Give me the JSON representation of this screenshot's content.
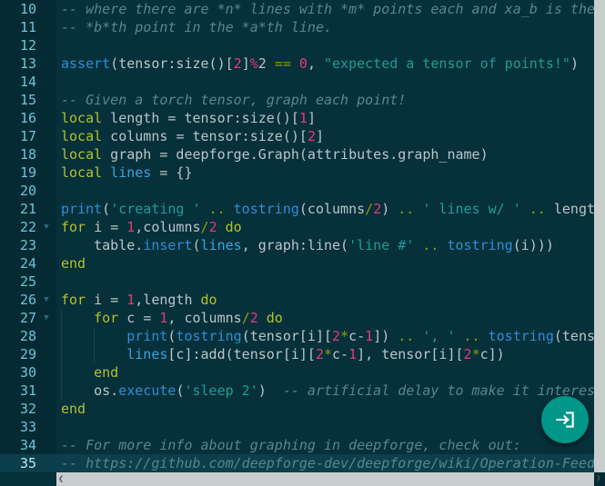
{
  "editor": {
    "language": "lua",
    "first_line": 10,
    "active_line": 35,
    "colors": {
      "background": "#06303a",
      "gutter_background": "#042b34",
      "active_line": "#0a3f4b",
      "comment": "#59868f",
      "keyword": "#b3c22b",
      "function": "#2f8fd6",
      "string": "#1d9e96",
      "number": "#e03c7a",
      "operator": "#8fa000",
      "plain_text": "#b9c6c9",
      "line_number": "#6fc3d6",
      "fab": "#009688",
      "scrollbar": "#c9cdce"
    },
    "lines": [
      {
        "number": "10",
        "fold": false,
        "indent_guides": 0,
        "active": false,
        "tokens": [
          {
            "t": "-- where there are *n* lines with *m* points each and xa_b is the x v",
            "c": "cm"
          }
        ]
      },
      {
        "number": "11",
        "fold": false,
        "indent_guides": 0,
        "active": false,
        "tokens": [
          {
            "t": "-- *b*th point in the *a*th line.",
            "c": "cm"
          }
        ]
      },
      {
        "number": "12",
        "fold": false,
        "indent_guides": 0,
        "active": false,
        "tokens": []
      },
      {
        "number": "13",
        "fold": false,
        "indent_guides": 0,
        "active": false,
        "tokens": [
          {
            "t": "assert",
            "c": "fn"
          },
          {
            "t": "(tensor:size()[",
            "c": "pl"
          },
          {
            "t": "2",
            "c": "num"
          },
          {
            "t": "]",
            "c": "pl"
          },
          {
            "t": "%",
            "c": "num"
          },
          {
            "t": "2",
            "c": "pl"
          },
          {
            "t": " ",
            "c": "pl"
          },
          {
            "t": "==",
            "c": "op"
          },
          {
            "t": " ",
            "c": "pl"
          },
          {
            "t": "0",
            "c": "num"
          },
          {
            "t": ", ",
            "c": "pl"
          },
          {
            "t": "\"expected a tensor of points!\"",
            "c": "str"
          },
          {
            "t": ")",
            "c": "pl"
          }
        ]
      },
      {
        "number": "14",
        "fold": false,
        "indent_guides": 0,
        "active": false,
        "tokens": []
      },
      {
        "number": "15",
        "fold": false,
        "indent_guides": 0,
        "active": false,
        "tokens": [
          {
            "t": "-- Given a torch tensor, graph each point!",
            "c": "cm"
          }
        ]
      },
      {
        "number": "16",
        "fold": false,
        "indent_guides": 0,
        "active": false,
        "tokens": [
          {
            "t": "local",
            "c": "kw"
          },
          {
            "t": " length ",
            "c": "pl"
          },
          {
            "t": "=",
            "c": "pl"
          },
          {
            "t": " tensor:size()[",
            "c": "pl"
          },
          {
            "t": "1",
            "c": "num"
          },
          {
            "t": "]",
            "c": "pl"
          }
        ]
      },
      {
        "number": "17",
        "fold": false,
        "indent_guides": 0,
        "active": false,
        "tokens": [
          {
            "t": "local",
            "c": "kw"
          },
          {
            "t": " columns ",
            "c": "pl"
          },
          {
            "t": "=",
            "c": "pl"
          },
          {
            "t": " tensor:size()[",
            "c": "pl"
          },
          {
            "t": "2",
            "c": "num"
          },
          {
            "t": "]",
            "c": "pl"
          }
        ]
      },
      {
        "number": "18",
        "fold": false,
        "indent_guides": 0,
        "active": false,
        "tokens": [
          {
            "t": "local",
            "c": "kw"
          },
          {
            "t": " graph ",
            "c": "pl"
          },
          {
            "t": "=",
            "c": "pl"
          },
          {
            "t": " deepforge.Graph(attributes.graph_name)",
            "c": "pl"
          }
        ]
      },
      {
        "number": "19",
        "fold": false,
        "indent_guides": 0,
        "active": false,
        "tokens": [
          {
            "t": "local",
            "c": "kw"
          },
          {
            "t": " ",
            "c": "pl"
          },
          {
            "t": "lines",
            "c": "var"
          },
          {
            "t": " ",
            "c": "pl"
          },
          {
            "t": "=",
            "c": "pl"
          },
          {
            "t": " {}",
            "c": "pl"
          }
        ]
      },
      {
        "number": "20",
        "fold": false,
        "indent_guides": 0,
        "active": false,
        "tokens": []
      },
      {
        "number": "21",
        "fold": false,
        "indent_guides": 0,
        "active": false,
        "tokens": [
          {
            "t": "print",
            "c": "fn"
          },
          {
            "t": "(",
            "c": "pl"
          },
          {
            "t": "'creating '",
            "c": "str"
          },
          {
            "t": " ",
            "c": "pl"
          },
          {
            "t": "..",
            "c": "op"
          },
          {
            "t": " ",
            "c": "pl"
          },
          {
            "t": "tostring",
            "c": "fn"
          },
          {
            "t": "(columns",
            "c": "pl"
          },
          {
            "t": "/",
            "c": "op"
          },
          {
            "t": "2",
            "c": "num"
          },
          {
            "t": ") ",
            "c": "pl"
          },
          {
            "t": "..",
            "c": "op"
          },
          {
            "t": " ",
            "c": "pl"
          },
          {
            "t": "' lines w/ '",
            "c": "str"
          },
          {
            "t": " ",
            "c": "pl"
          },
          {
            "t": "..",
            "c": "op"
          },
          {
            "t": " length ",
            "c": "pl"
          },
          {
            "t": "..",
            "c": "op"
          }
        ]
      },
      {
        "number": "22",
        "fold": true,
        "indent_guides": 0,
        "active": false,
        "tokens": [
          {
            "t": "for",
            "c": "kw"
          },
          {
            "t": " i ",
            "c": "pl"
          },
          {
            "t": "=",
            "c": "pl"
          },
          {
            "t": " ",
            "c": "pl"
          },
          {
            "t": "1",
            "c": "num"
          },
          {
            "t": ",columns",
            "c": "pl"
          },
          {
            "t": "/",
            "c": "op"
          },
          {
            "t": "2",
            "c": "num"
          },
          {
            "t": " ",
            "c": "pl"
          },
          {
            "t": "do",
            "c": "kw"
          }
        ]
      },
      {
        "number": "23",
        "fold": false,
        "indent_guides": 0,
        "active": false,
        "tokens": [
          {
            "t": "    table.",
            "c": "pl"
          },
          {
            "t": "insert",
            "c": "fn"
          },
          {
            "t": "(",
            "c": "pl"
          },
          {
            "t": "lines",
            "c": "var"
          },
          {
            "t": ", graph:line(",
            "c": "pl"
          },
          {
            "t": "'line #'",
            "c": "str"
          },
          {
            "t": " ",
            "c": "pl"
          },
          {
            "t": "..",
            "c": "op"
          },
          {
            "t": " ",
            "c": "pl"
          },
          {
            "t": "tostring",
            "c": "fn"
          },
          {
            "t": "(i)))",
            "c": "pl"
          }
        ]
      },
      {
        "number": "24",
        "fold": false,
        "indent_guides": 0,
        "active": false,
        "tokens": [
          {
            "t": "end",
            "c": "kw"
          }
        ]
      },
      {
        "number": "25",
        "fold": false,
        "indent_guides": 0,
        "active": false,
        "tokens": []
      },
      {
        "number": "26",
        "fold": true,
        "indent_guides": 0,
        "active": false,
        "tokens": [
          {
            "t": "for",
            "c": "kw"
          },
          {
            "t": " i ",
            "c": "pl"
          },
          {
            "t": "=",
            "c": "pl"
          },
          {
            "t": " ",
            "c": "pl"
          },
          {
            "t": "1",
            "c": "num"
          },
          {
            "t": ",length ",
            "c": "pl"
          },
          {
            "t": "do",
            "c": "kw"
          }
        ]
      },
      {
        "number": "27",
        "fold": true,
        "indent_guides": 1,
        "active": false,
        "tokens": [
          {
            "t": "    ",
            "c": "pl"
          },
          {
            "t": "for",
            "c": "kw"
          },
          {
            "t": " c ",
            "c": "pl"
          },
          {
            "t": "=",
            "c": "pl"
          },
          {
            "t": " ",
            "c": "pl"
          },
          {
            "t": "1",
            "c": "num"
          },
          {
            "t": ", columns",
            "c": "pl"
          },
          {
            "t": "/",
            "c": "op"
          },
          {
            "t": "2",
            "c": "num"
          },
          {
            "t": " ",
            "c": "pl"
          },
          {
            "t": "do",
            "c": "kw"
          }
        ]
      },
      {
        "number": "28",
        "fold": false,
        "indent_guides": 2,
        "active": false,
        "tokens": [
          {
            "t": "        ",
            "c": "pl"
          },
          {
            "t": "print",
            "c": "fn"
          },
          {
            "t": "(",
            "c": "pl"
          },
          {
            "t": "tostring",
            "c": "fn"
          },
          {
            "t": "(tensor[i][",
            "c": "pl"
          },
          {
            "t": "2",
            "c": "num"
          },
          {
            "t": "*",
            "c": "op"
          },
          {
            "t": "c-",
            "c": "pl"
          },
          {
            "t": "1",
            "c": "num"
          },
          {
            "t": "]) ",
            "c": "pl"
          },
          {
            "t": "..",
            "c": "op"
          },
          {
            "t": " ",
            "c": "pl"
          },
          {
            "t": "', '",
            "c": "str"
          },
          {
            "t": " ",
            "c": "pl"
          },
          {
            "t": "..",
            "c": "op"
          },
          {
            "t": " ",
            "c": "pl"
          },
          {
            "t": "tostring",
            "c": "fn"
          },
          {
            "t": "(tensor[i][",
            "c": "pl"
          }
        ]
      },
      {
        "number": "29",
        "fold": false,
        "indent_guides": 2,
        "active": false,
        "tokens": [
          {
            "t": "        ",
            "c": "pl"
          },
          {
            "t": "lines",
            "c": "var"
          },
          {
            "t": "[c]:add(tensor[i][",
            "c": "pl"
          },
          {
            "t": "2",
            "c": "num"
          },
          {
            "t": "*",
            "c": "op"
          },
          {
            "t": "c-",
            "c": "pl"
          },
          {
            "t": "1",
            "c": "num"
          },
          {
            "t": "], tensor[i][",
            "c": "pl"
          },
          {
            "t": "2",
            "c": "num"
          },
          {
            "t": "*",
            "c": "op"
          },
          {
            "t": "c])",
            "c": "pl"
          }
        ]
      },
      {
        "number": "30",
        "fold": false,
        "indent_guides": 1,
        "active": false,
        "tokens": [
          {
            "t": "    ",
            "c": "pl"
          },
          {
            "t": "end",
            "c": "kw"
          }
        ]
      },
      {
        "number": "31",
        "fold": false,
        "indent_guides": 1,
        "active": false,
        "tokens": [
          {
            "t": "    os.",
            "c": "pl"
          },
          {
            "t": "execute",
            "c": "fn"
          },
          {
            "t": "(",
            "c": "pl"
          },
          {
            "t": "'sleep 2'",
            "c": "str"
          },
          {
            "t": ")  ",
            "c": "pl"
          },
          {
            "t": "-- artificial delay to make it interesting",
            "c": "cm"
          }
        ]
      },
      {
        "number": "32",
        "fold": false,
        "indent_guides": 0,
        "active": false,
        "tokens": [
          {
            "t": "end",
            "c": "kw"
          }
        ]
      },
      {
        "number": "33",
        "fold": false,
        "indent_guides": 0,
        "active": false,
        "tokens": []
      },
      {
        "number": "34",
        "fold": false,
        "indent_guides": 0,
        "active": false,
        "tokens": [
          {
            "t": "-- For more info about graphing in deepforge, check out:",
            "c": "cm"
          }
        ]
      },
      {
        "number": "35",
        "fold": false,
        "indent_guides": 0,
        "active": true,
        "tokens": [
          {
            "t": "-- https://github.com/deepforge-dev/deepforge/wiki/Operation-Feedback",
            "c": "cm"
          }
        ]
      }
    ]
  },
  "fab": {
    "icon": "enter-arrow-icon",
    "label": "Execute"
  },
  "scrollbars": {
    "vertical_arrow": "chevron-down-icon",
    "horizontal_arrow": "chevron-left-icon"
  }
}
